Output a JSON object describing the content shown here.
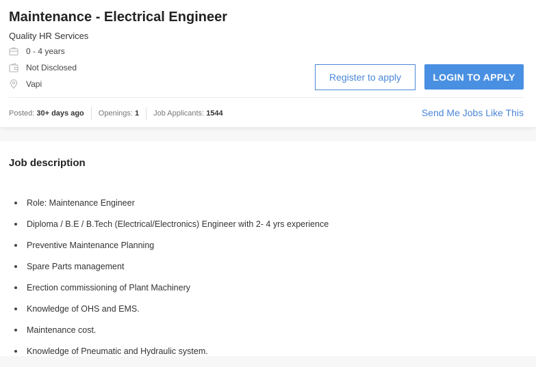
{
  "job": {
    "title": "Maintenance - Electrical Engineer",
    "company": "Quality HR Services",
    "experience": "0 - 4 years",
    "salary": "Not Disclosed",
    "location": "Vapi"
  },
  "actions": {
    "register_label": "Register to apply",
    "login_label": "LOGIN TO APPLY",
    "send_jobs_label": "Send Me Jobs Like This"
  },
  "stats": {
    "posted_label": "Posted:",
    "posted_value": "30+ days ago",
    "openings_label": "Openings:",
    "openings_value": "1",
    "applicants_label": "Job Applicants:",
    "applicants_value": "1544"
  },
  "description": {
    "heading": "Job description",
    "items": [
      "Role: Maintenance Engineer",
      "Diploma / B.E / B.Tech (Electrical/Electronics) Engineer with 2- 4 yrs experience",
      "Preventive Maintenance Planning",
      "Spare Parts management",
      "Erection commissioning of Plant Machinery",
      "Knowledge of OHS and EMS.",
      "Maintenance cost.",
      "Knowledge of Pneumatic and Hydraulic system."
    ]
  },
  "colors": {
    "accent": "#4a90e2",
    "link": "#4a86d8",
    "icon": "#b5b5b5"
  },
  "icons": {
    "experience": "briefcase-icon",
    "salary": "wallet-icon",
    "location": "location-pin-icon"
  }
}
